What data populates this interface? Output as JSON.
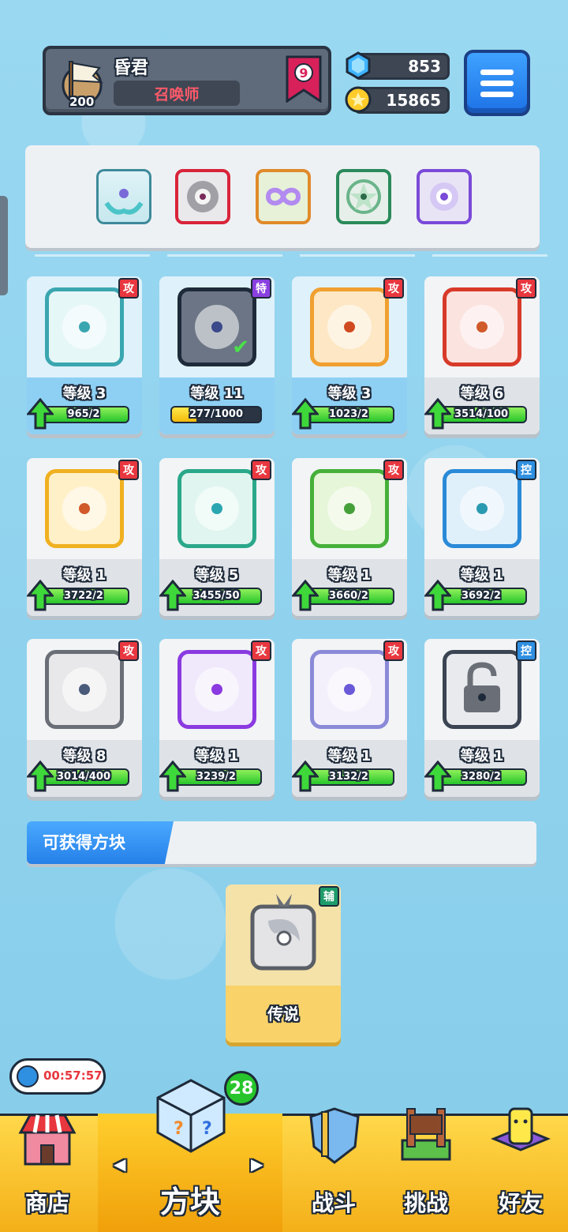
{
  "header": {
    "player_name": "昏君",
    "player_title": "召唤师",
    "player_level": "200",
    "rank": "9",
    "gems": "853",
    "coins": "15865"
  },
  "equipped": [
    "heal-hands-block",
    "red-vortex-block",
    "rainbow-infinity-block",
    "green-star-block",
    "purple-eye-block"
  ],
  "cards": [
    {
      "tag": "攻",
      "level": "等级 3",
      "progress": "965/2",
      "fill": 1.0,
      "owned": true
    },
    {
      "tag": "特",
      "level": "等级 11",
      "progress": "277/1000",
      "fill": 0.28,
      "owned": true
    },
    {
      "tag": "攻",
      "level": "等级 3",
      "progress": "1023/2",
      "fill": 1.0,
      "owned": true
    },
    {
      "tag": "攻",
      "level": "等级 6",
      "progress": "3514/100",
      "fill": 1.0,
      "owned": false
    },
    {
      "tag": "攻",
      "level": "等级 1",
      "progress": "3722/2",
      "fill": 1.0,
      "owned": false
    },
    {
      "tag": "攻",
      "level": "等级 5",
      "progress": "3455/50",
      "fill": 1.0,
      "owned": false
    },
    {
      "tag": "攻",
      "level": "等级 1",
      "progress": "3660/2",
      "fill": 1.0,
      "owned": false
    },
    {
      "tag": "控",
      "level": "等级 1",
      "progress": "3692/2",
      "fill": 1.0,
      "owned": false
    },
    {
      "tag": "攻",
      "level": "等级 8",
      "progress": "3014/400",
      "fill": 1.0,
      "owned": false
    },
    {
      "tag": "攻",
      "level": "等级 1",
      "progress": "3239/2",
      "fill": 1.0,
      "owned": false
    },
    {
      "tag": "攻",
      "level": "等级 1",
      "progress": "3132/2",
      "fill": 1.0,
      "owned": false
    },
    {
      "tag": "控",
      "level": "等级 1",
      "progress": "3280/2",
      "fill": 1.0,
      "owned": false
    }
  ],
  "obtainable": {
    "title": "可获得方块",
    "item_tag": "辅",
    "item_name": "传说"
  },
  "timer": "00:57:57",
  "nav": {
    "shop": "商店",
    "blocks": "方块",
    "blocks_badge": "28",
    "battle": "战斗",
    "challenge": "挑战",
    "friends": "好友"
  },
  "colors": {
    "attack_tag": "#e8373f",
    "special_tag": "#8a3fe0",
    "control_tag": "#2f8fe0",
    "support_tag": "#1e9c6a",
    "progress_green": "#27c52b",
    "progress_yellow": "#f3b90a"
  }
}
